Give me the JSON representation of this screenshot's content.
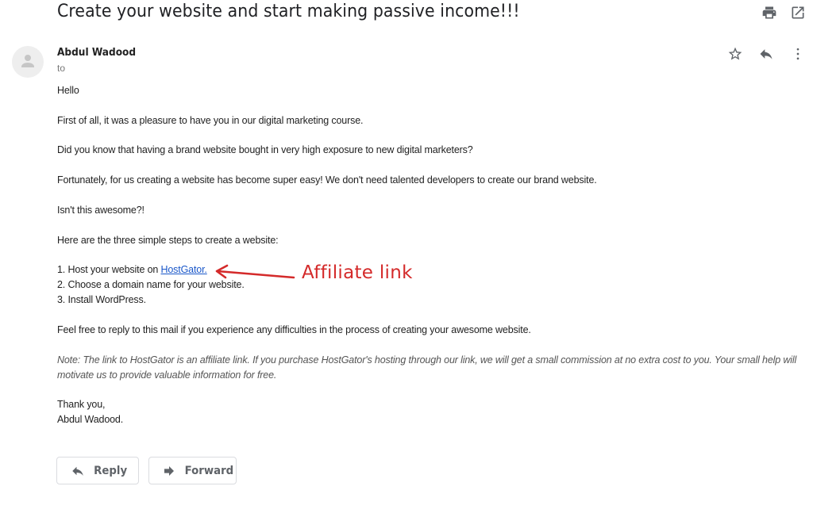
{
  "email": {
    "subject": "Create your website and start making passive income!!!",
    "sender": {
      "name": "Abdul Wadood",
      "to_label": "to"
    },
    "toolbar_icons": [
      "print-icon",
      "open-in-new-window-icon"
    ],
    "header_icons": [
      "star-icon",
      "reply-icon",
      "more-vert-icon"
    ],
    "body": {
      "greeting": "Hello",
      "p1": "First of all, it was a pleasure to have you in our digital marketing course.",
      "p2": "Did you know that having a brand website bought in very high exposure to new digital marketers?",
      "p3": "Fortunately, for us creating a website has become super easy! We don't need talented developers to create our brand website.",
      "p4": "Isn't this awesome?!",
      "p5": "Here are the three simple steps to create a website:",
      "steps": [
        {
          "prefix": "1. Host your website on ",
          "link": "HostGator."
        },
        {
          "prefix": "2. Choose a domain name for your website."
        },
        {
          "prefix": "3. Install WordPress."
        }
      ],
      "p6": "Feel free to reply to this mail if you experience any difficulties in the process of creating your awesome website.",
      "note": "Note: The link to HostGator is an affiliate link. If you purchase HostGator's hosting through our link, we will get a small commission at no extra cost to you. Your small help will motivate us to provide valuable information for free.",
      "closing": "Thank you,",
      "signature": "Abdul Wadood."
    },
    "annotation": {
      "label": "Affiliate link",
      "color": "#d42a2a"
    },
    "actions": {
      "reply_label": "Reply",
      "forward_label": "Forward"
    }
  }
}
